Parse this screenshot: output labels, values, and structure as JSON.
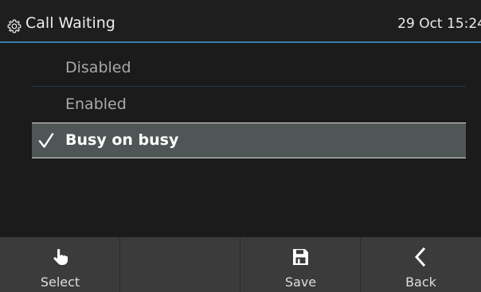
{
  "header": {
    "title": "Call Waiting",
    "datetime": "29 Oct 15:24",
    "icon": "gear-icon"
  },
  "options": [
    {
      "label": "Disabled",
      "selected": false
    },
    {
      "label": "Enabled",
      "selected": false
    },
    {
      "label": "Busy on busy",
      "selected": true
    }
  ],
  "softkeys": [
    {
      "label": "Select",
      "icon": "hand-pointer-icon"
    },
    {
      "label": "",
      "icon": ""
    },
    {
      "label": "Save",
      "icon": "save-icon"
    },
    {
      "label": "Back",
      "icon": "chevron-left-icon"
    }
  ],
  "colors": {
    "accent": "#3a7fa8",
    "selected_row": "#4f5656",
    "softkey_bar": "#3b3b3b",
    "background": "#1b1b1b"
  }
}
